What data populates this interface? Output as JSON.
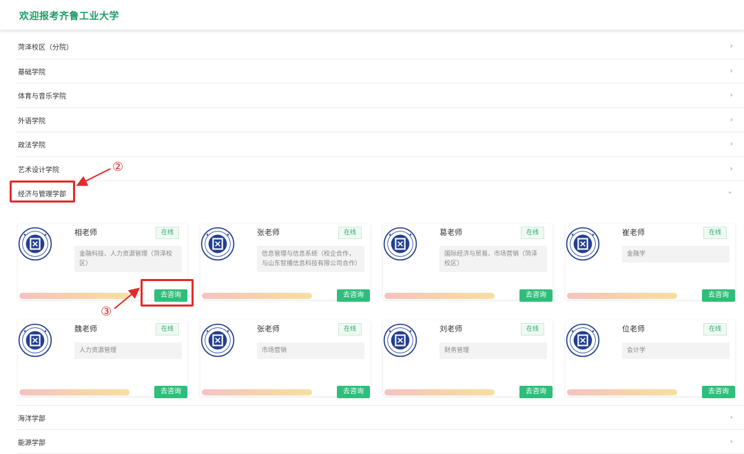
{
  "header": {
    "title": "欢迎报考齐鲁工业大学"
  },
  "departments_top": [
    {
      "label": "菏泽校区（分院）"
    },
    {
      "label": "基础学院"
    },
    {
      "label": "体育与音乐学院"
    },
    {
      "label": "外语学院"
    },
    {
      "label": "政法学院"
    },
    {
      "label": "艺术设计学院"
    },
    {
      "label": "经济与管理学部"
    }
  ],
  "teachers": [
    {
      "name": "相老师",
      "status": "在线",
      "desc": "金融科技、人力资源管理（菏泽校区）",
      "button": "去咨询"
    },
    {
      "name": "张老师",
      "status": "在线",
      "desc": "信息管理与信息系统（校企合作，与山东智播信息科技有限公司合作）",
      "button": "去咨询"
    },
    {
      "name": "葛老师",
      "status": "在线",
      "desc": "国际经济与贸易、市场营销（菏泽校区）",
      "button": "去咨询"
    },
    {
      "name": "崔老师",
      "status": "在线",
      "desc": "金融学",
      "button": "去咨询"
    },
    {
      "name": "魏老师",
      "status": "在线",
      "desc": "人力资源管理",
      "button": "去咨询"
    },
    {
      "name": "张老师",
      "status": "在线",
      "desc": "市场营销",
      "button": "去咨询"
    },
    {
      "name": "刘老师",
      "status": "在线",
      "desc": "财务管理",
      "button": "去咨询"
    },
    {
      "name": "位老师",
      "status": "在线",
      "desc": "会计学",
      "button": "去咨询"
    }
  ],
  "departments_bottom": [
    {
      "label": "海洋学部"
    },
    {
      "label": "能源学部"
    }
  ],
  "annotations": {
    "n2": "②",
    "n3": "③"
  },
  "colors": {
    "accent": "#2fbe7a",
    "title": "#1e9c66",
    "annotation": "#e32a2a"
  },
  "icons": {
    "chevron": "chevron-right-icon",
    "expanded": "chevron-down-icon",
    "logo": "university-seal-logo"
  }
}
